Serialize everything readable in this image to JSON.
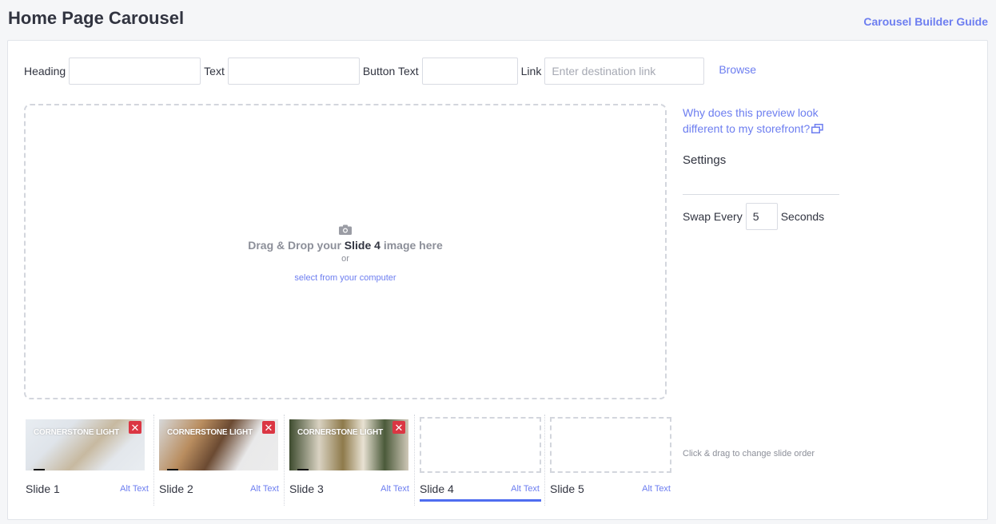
{
  "header": {
    "title": "Home Page Carousel",
    "guide_link": "Carousel Builder Guide"
  },
  "fields": {
    "heading_label": "Heading",
    "heading_value": "",
    "text_label": "Text",
    "text_value": "",
    "button_text_label": "Button Text",
    "button_text_value": "",
    "link_label": "Link",
    "link_value": "",
    "link_placeholder": "Enter destination link",
    "browse_label": "Browse"
  },
  "dropzone": {
    "icon": "camera-icon",
    "text_before": "Drag & Drop your ",
    "text_slide": "Slide 4",
    "text_after": " image here",
    "or": "or",
    "select_link": "select from your computer"
  },
  "sidebar": {
    "preview_link": "Why does this preview look different to my storefront?",
    "preview_icon": "external-window-icon",
    "settings_heading": "Settings",
    "swap_label": "Swap Every",
    "swap_value": "5",
    "seconds_label": "Seconds",
    "drag_hint": "Click & drag to change slide order"
  },
  "slides": [
    {
      "name": "Slide 1",
      "alt": "Alt Text",
      "has_image": true,
      "thumb_title": "CORNERSTONE LIGHT",
      "delete": "✕"
    },
    {
      "name": "Slide 2",
      "alt": "Alt Text",
      "has_image": true,
      "thumb_title": "CORNERSTONE LIGHT",
      "delete": "✕"
    },
    {
      "name": "Slide 3",
      "alt": "Alt Text",
      "has_image": true,
      "thumb_title": "CORNERSTONE LIGHT",
      "delete": "✕"
    },
    {
      "name": "Slide 4",
      "alt": "Alt Text",
      "has_image": false,
      "active": true
    },
    {
      "name": "Slide 5",
      "alt": "Alt Text",
      "has_image": false
    }
  ],
  "colors": {
    "accent": "#6d7ef0",
    "active_tab": "#4f6df0",
    "delete": "#db3643",
    "background": "#f5f6f8"
  }
}
